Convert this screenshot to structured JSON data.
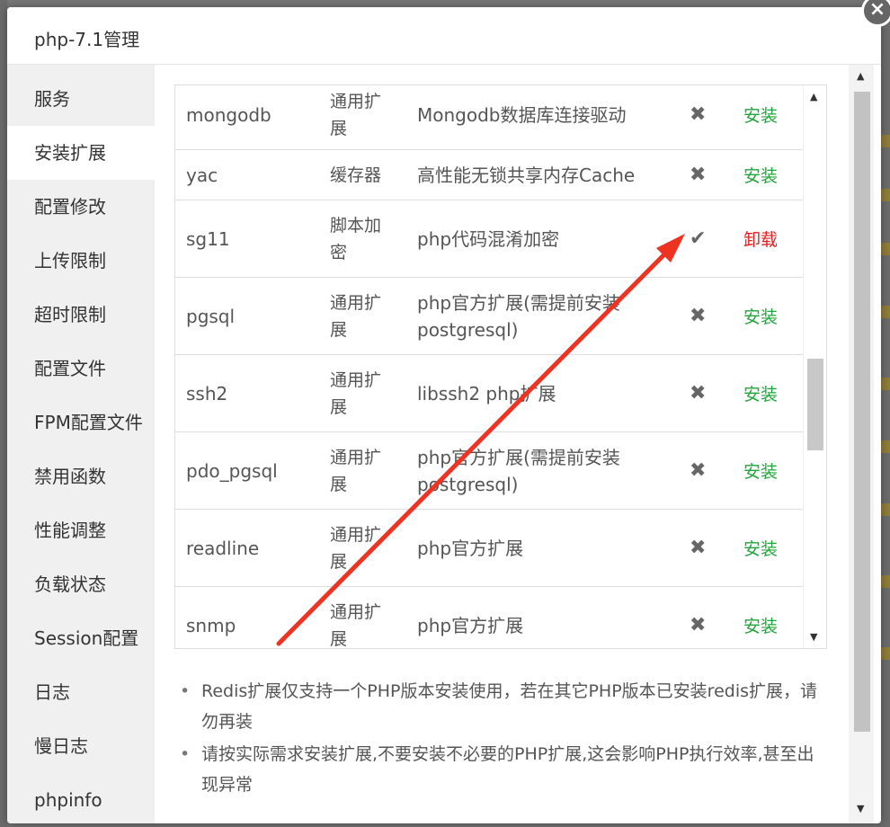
{
  "modal": {
    "title": "php-7.1管理",
    "close_glyph": "×"
  },
  "sidebar": {
    "items": [
      {
        "label": "服务"
      },
      {
        "label": "安装扩展",
        "active": true
      },
      {
        "label": "配置修改"
      },
      {
        "label": "上传限制"
      },
      {
        "label": "超时限制"
      },
      {
        "label": "配置文件"
      },
      {
        "label": "FPM配置文件"
      },
      {
        "label": "禁用函数"
      },
      {
        "label": "性能调整"
      },
      {
        "label": "负载状态"
      },
      {
        "label": "Session配置"
      },
      {
        "label": "日志"
      },
      {
        "label": "慢日志"
      },
      {
        "label": "phpinfo"
      }
    ]
  },
  "extensions": [
    {
      "name": "mongodb",
      "type": "通用扩展",
      "desc": "Mongodb数据库连接驱动",
      "status": "✖",
      "action": "安装"
    },
    {
      "name": "yac",
      "type": "缓存器",
      "desc": "高性能无锁共享内存Cache",
      "status": "✖",
      "action": "安装"
    },
    {
      "name": "sg11",
      "type": "脚本加密",
      "desc": "php代码混淆加密",
      "status": "✔",
      "action": "卸载"
    },
    {
      "name": "pgsql",
      "type": "通用扩展",
      "desc": "php官方扩展(需提前安装postgresql)",
      "status": "✖",
      "action": "安装"
    },
    {
      "name": "ssh2",
      "type": "通用扩展",
      "desc": "libssh2 php扩展",
      "status": "✖",
      "action": "安装"
    },
    {
      "name": "pdo_pgsql",
      "type": "通用扩展",
      "desc": "php官方扩展(需提前安装postgresql)",
      "status": "✖",
      "action": "安装"
    },
    {
      "name": "readline",
      "type": "通用扩展",
      "desc": "php官方扩展",
      "status": "✖",
      "action": "安装"
    },
    {
      "name": "snmp",
      "type": "通用扩展",
      "desc": "php官方扩展",
      "status": "✖",
      "action": "安装"
    }
  ],
  "scroll": {
    "up": "▲",
    "down": "▼"
  },
  "notes": [
    "Redis扩展仅支持一个PHP版本安装使用，若在其它PHP版本已安装redis扩展，请勿再装",
    "请按实际需求安装扩展,不要安装不必要的PHP扩展,这会影响PHP执行效率,甚至出现异常"
  ],
  "colors": {
    "install": "#20a53a",
    "uninstall": "#e02020",
    "arrow": "#ee3322"
  }
}
